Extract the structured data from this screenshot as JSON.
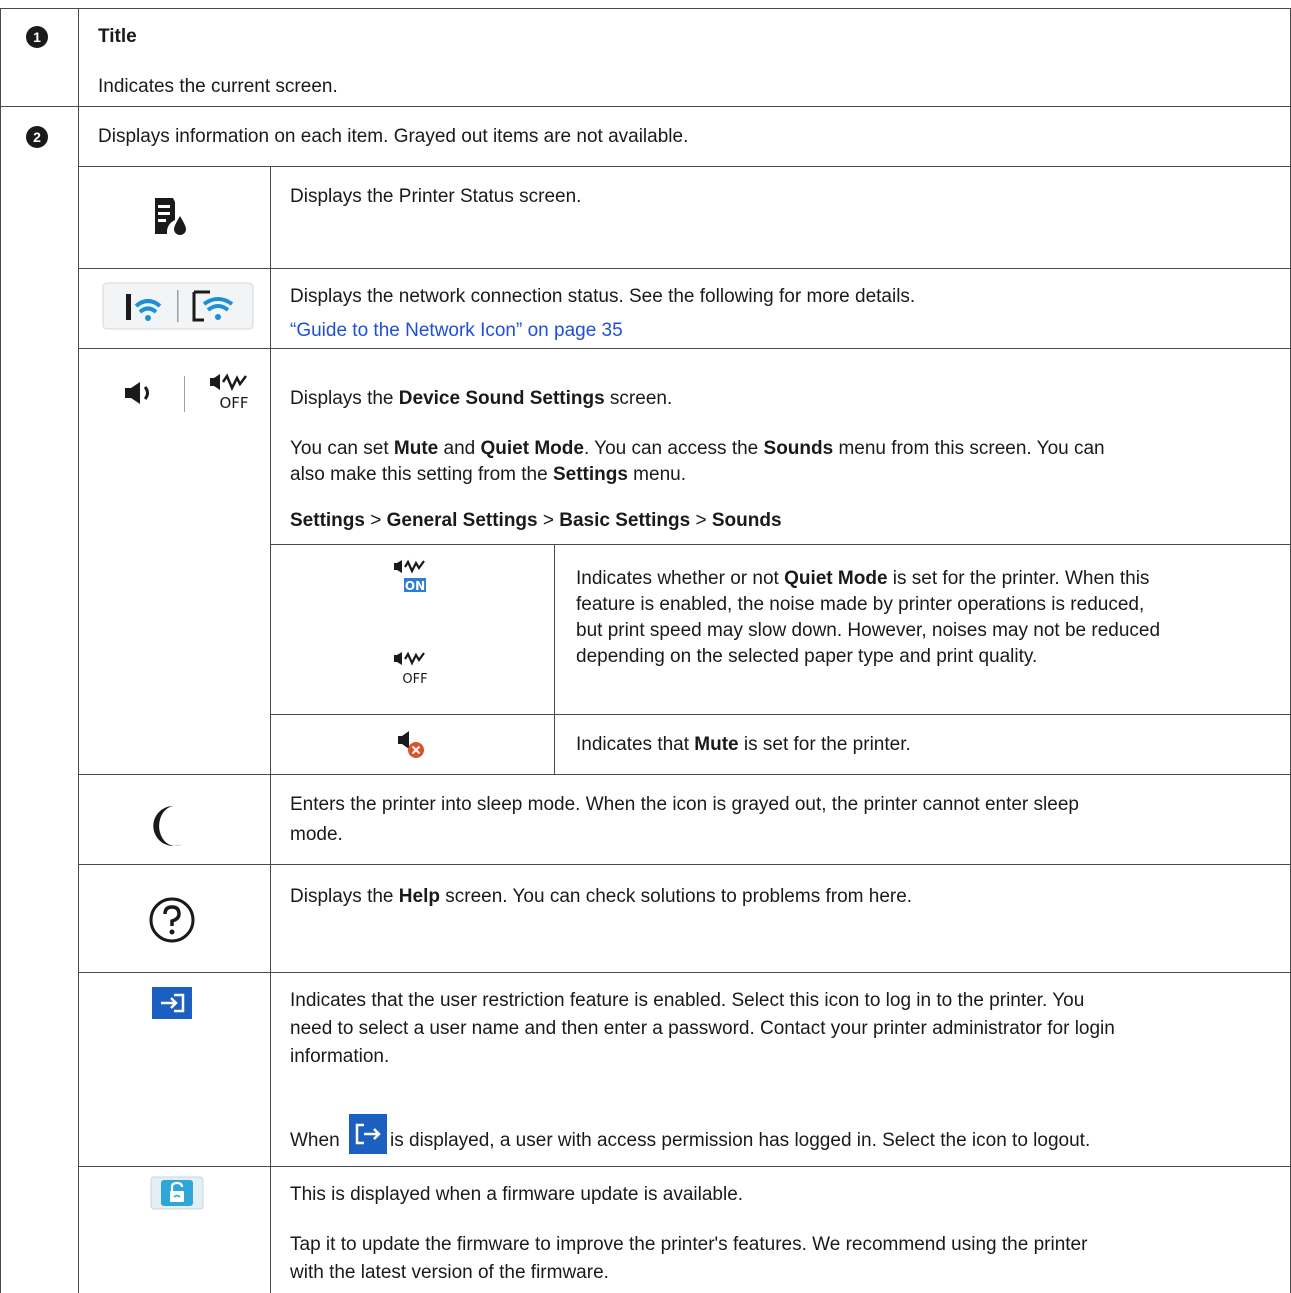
{
  "row1": {
    "badge": "1",
    "title": "Title",
    "description": "Indicates the current screen."
  },
  "row2": {
    "badge": "2",
    "intro": "Displays information on each item. Grayed out items are not available.",
    "items": {
      "status": {
        "icon": "printer-status-icon",
        "text": "Displays the Printer Status screen."
      },
      "network": {
        "icon": "wifi-network-icons",
        "text": "Displays the network connection status. See the following for more details.",
        "link": "“Guide to the Network Icon” on page 35"
      },
      "sound": {
        "icon": "speaker-quiet-off-icons",
        "line1_pre": "Displays the ",
        "line1_bold": "Device Sound Settings",
        "line1_post": " screen.",
        "p2_a": "You can set ",
        "p2_mute": "Mute",
        "p2_b": " and ",
        "p2_quiet": "Quiet Mode",
        "p2_c": ". You can access the ",
        "p2_sounds": "Sounds",
        "p2_d": " menu from this screen. You can",
        "p2_e": "also make this setting from the ",
        "p2_settings": "Settings",
        "p2_f": " menu.",
        "path": [
          "Settings",
          "General Settings",
          "Basic Settings",
          "Sounds"
        ],
        "path_sep": " > ",
        "sub": {
          "quiet_on_label": "ON",
          "quiet_off_label": "OFF",
          "quiet_l1_pre": "Indicates whether or not ",
          "quiet_l1_bold": "Quiet Mode",
          "quiet_l1_post": " is set for the printer. When this",
          "quiet_l2": "feature is enabled, the noise made by printer operations is reduced,",
          "quiet_l3": "but print speed may slow down. However, noises may not be reduced",
          "quiet_l4": "depending on the selected paper type and print quality.",
          "mute_pre": "Indicates that ",
          "mute_bold": "Mute",
          "mute_post": " is set for the printer."
        }
      },
      "sleep": {
        "icon": "moon-icon",
        "l1": "Enters the printer into sleep mode. When the icon is grayed out, the printer cannot enter sleep",
        "l2": "mode."
      },
      "help": {
        "icon": "help-icon",
        "pre": "Displays the ",
        "bold": "Help",
        "post": " screen. You can check solutions to problems from here."
      },
      "login": {
        "icon": "login-icon",
        "l1": "Indicates that the user restriction feature is enabled. Select this icon to log in to the printer. You",
        "l2": "need to select a user name and then enter a password. Contact your printer administrator for login",
        "l3": "information.",
        "w_pre": "When",
        "w_post": "is displayed, a user with access permission has logged in. Select the icon to logout."
      },
      "firmware": {
        "icon": "firmware-update-icon",
        "l1": "This is displayed when a firmware update is available.",
        "l2": "Tap it to update the firmware to improve the printer's features. We recommend using the printer",
        "l3": "with the latest version of the firmware."
      }
    }
  },
  "colors": {
    "border": "#4a4a4a",
    "link": "#1f4fd8",
    "accent_blue": "#1b5fc1",
    "mute_red": "#e0502a",
    "quiet_on_blue": "#2a7fd4"
  }
}
